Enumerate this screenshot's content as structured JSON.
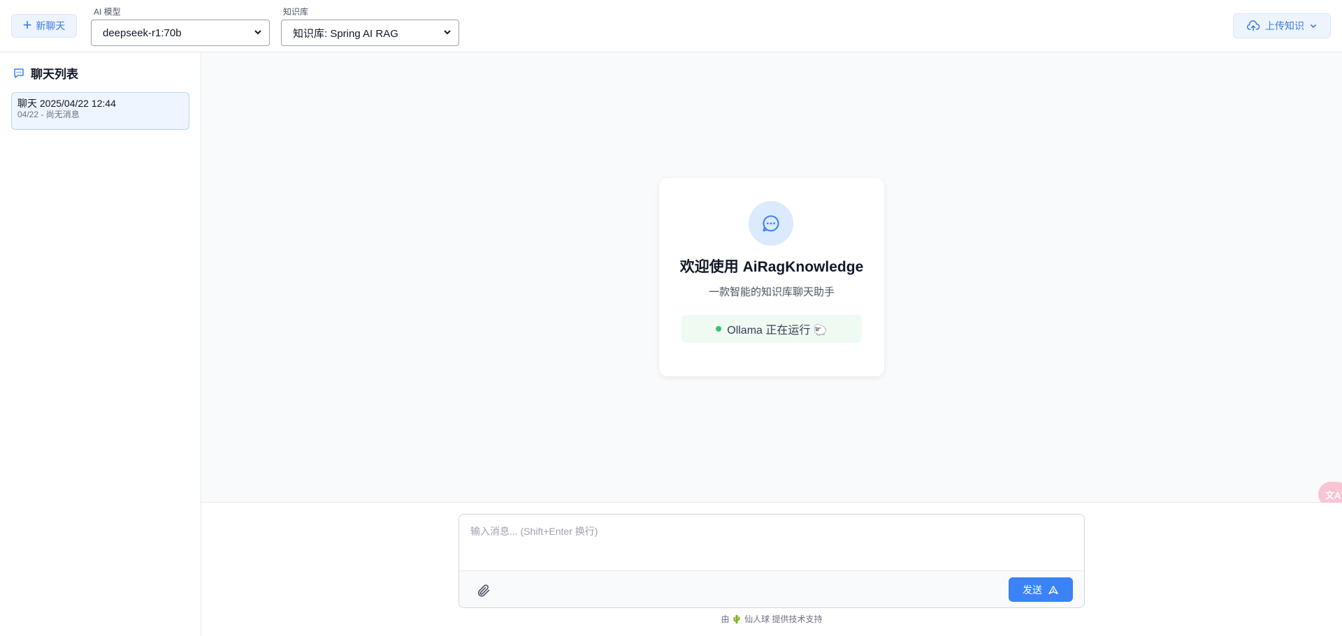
{
  "header": {
    "new_chat_label": "新聊天",
    "model_label": "AI 模型",
    "model_value": "deepseek-r1:70b",
    "kb_label": "知识库",
    "kb_value": "知识库: Spring AI RAG",
    "upload_label": "上传知识"
  },
  "sidebar": {
    "title": "聊天列表",
    "chats": [
      {
        "title": "聊天 2025/04/22 12:44",
        "subtitle": "04/22 - 尚无消息"
      }
    ]
  },
  "welcome": {
    "title": "欢迎使用 AiRagKnowledge",
    "subtitle": "一款智能的知识库聊天助手",
    "status_text": "Ollama 正在运行 🐑"
  },
  "input": {
    "placeholder": "输入消息... (Shift+Enter 换行)",
    "send_label": "发送"
  },
  "footer": {
    "text": "由 🌵 仙人球 提供技术支持"
  },
  "translate_fab": "文A",
  "colors": {
    "accent": "#3b82f6",
    "accent_light": "#eef4fd",
    "status_green": "#34c66e",
    "status_bg": "#effaf3"
  }
}
